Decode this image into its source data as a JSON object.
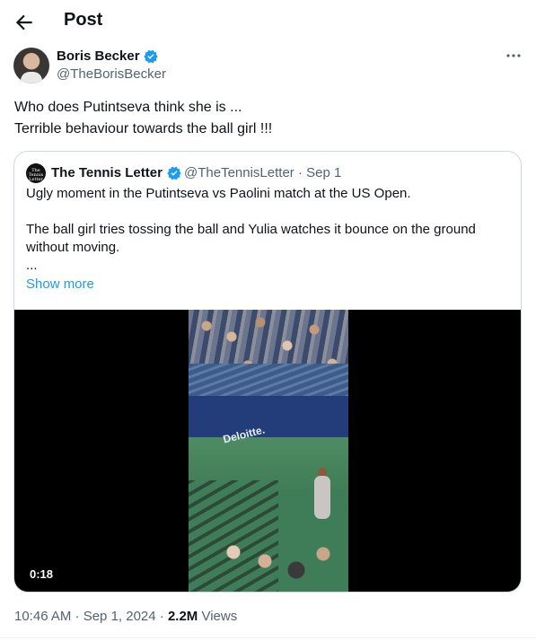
{
  "header": {
    "title": "Post"
  },
  "post": {
    "author": {
      "name": "Boris Becker",
      "handle": "@TheBorisBecker"
    },
    "text_lines": [
      "Who does Putintseva think she is ...",
      "Terrible behaviour towards the ball girl !!!"
    ],
    "timestamp": "10:46 AM · Sep 1, 2024 ·",
    "views_count": "2.2M",
    "views_label": "Views"
  },
  "quote": {
    "avatar_text": "The Tennis Letter",
    "author": {
      "name": "The Tennis Letter",
      "handle_date": "@TheTennisLetter · Sep 1"
    },
    "paragraphs": [
      "Ugly moment in the Putintseva vs Paolini match at the US Open.",
      "The ball girl tries tossing the ball and Yulia watches it bounce on the ground without moving.",
      "..."
    ],
    "show_more": "Show more",
    "video": {
      "duration": "0:18",
      "wall_text": "Deloitte."
    }
  },
  "colors": {
    "accent": "#1d9bf0",
    "text": "#0f1419",
    "muted": "#536471",
    "border": "#cfd9de"
  },
  "icons": {
    "back": "arrow-left-icon",
    "verified": "verified-badge-icon",
    "more": "more-horizontal-icon"
  }
}
